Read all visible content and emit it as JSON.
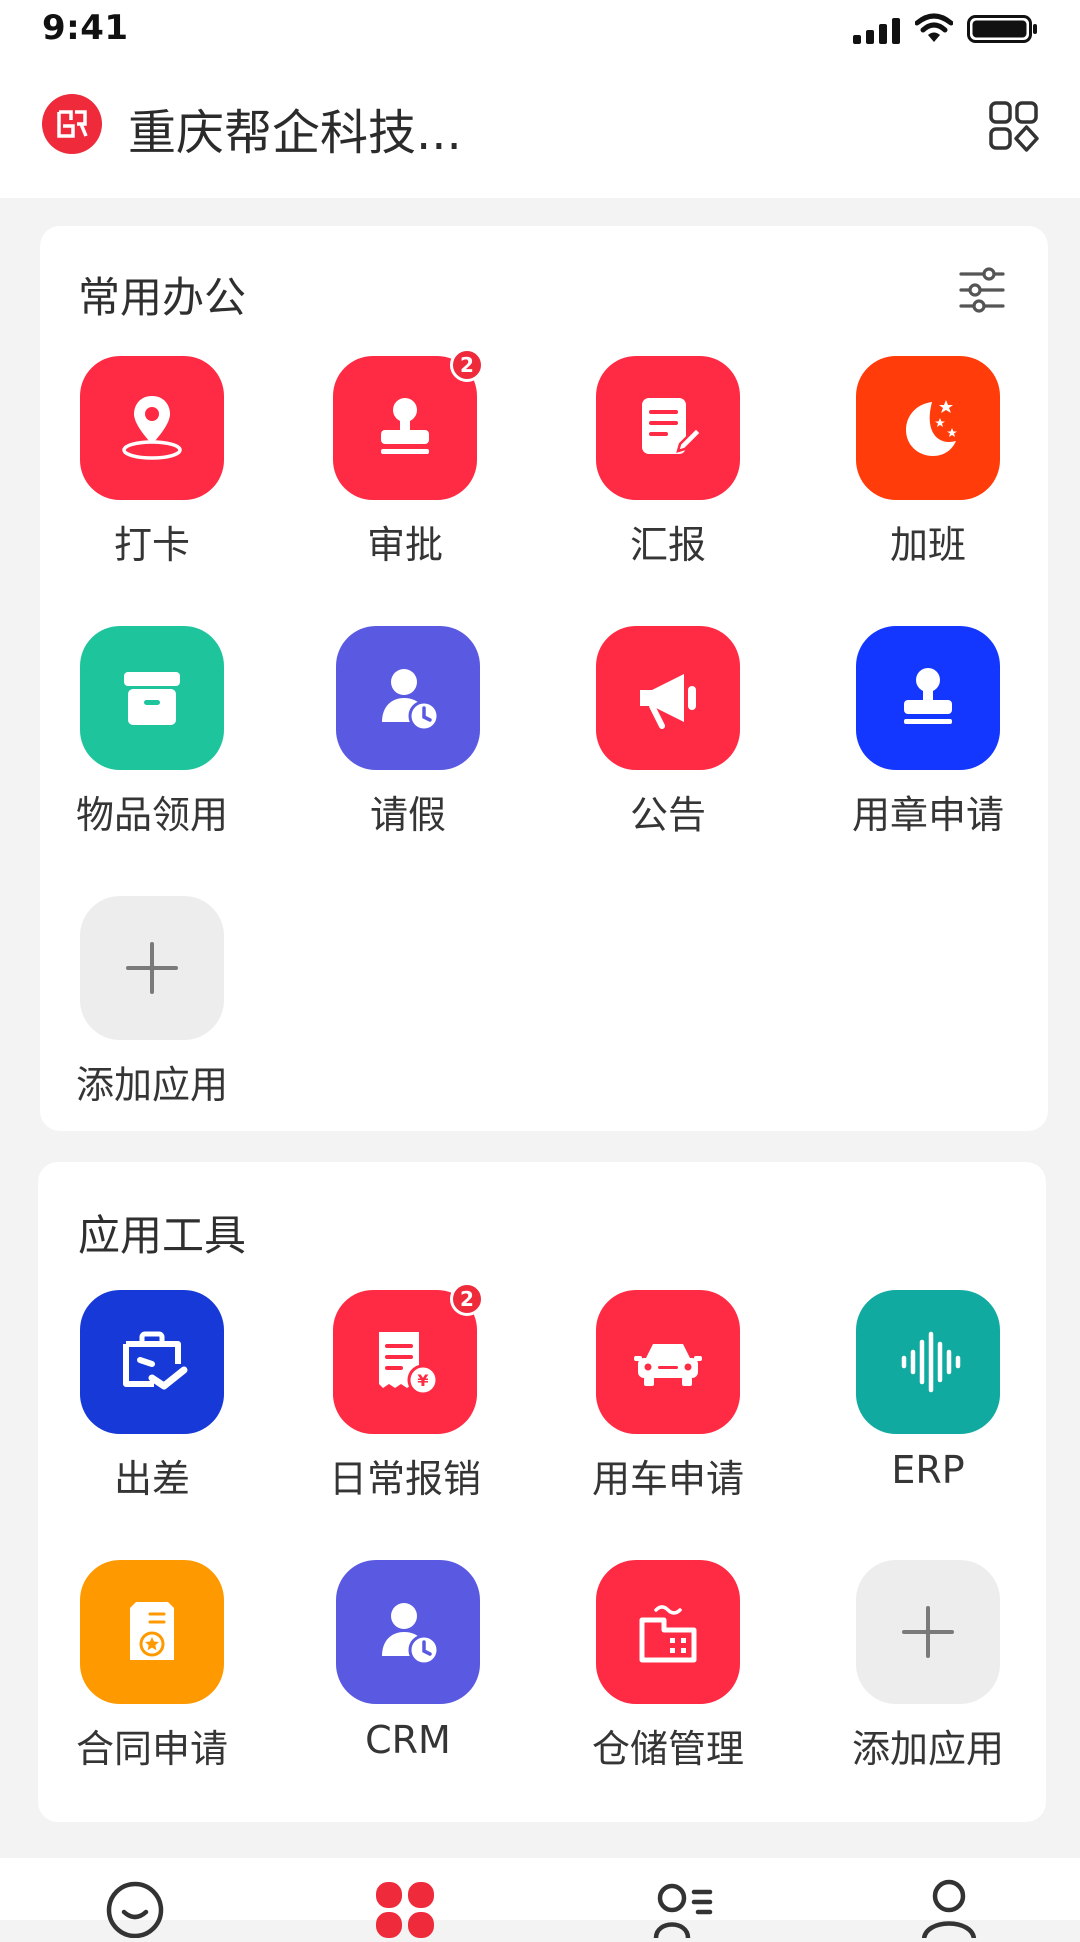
{
  "status": {
    "time": "9:41"
  },
  "header": {
    "company_name": "重庆帮企科技..."
  },
  "sections": [
    {
      "title": "常用办公",
      "apps": [
        {
          "label": "打卡",
          "icon": "location-pin-icon",
          "color": "#ff2a43"
        },
        {
          "label": "审批",
          "icon": "stamp-icon",
          "color": "#ff2a43",
          "badge": "2"
        },
        {
          "label": "汇报",
          "icon": "report-edit-icon",
          "color": "#ff2a43"
        },
        {
          "label": "加班",
          "icon": "moon-stars-icon",
          "color": "#ff3c0a"
        },
        {
          "label": "物品领用",
          "icon": "archive-box-icon",
          "color": "#1ec59c"
        },
        {
          "label": "请假",
          "icon": "person-clock-icon",
          "color": "#5a59e2"
        },
        {
          "label": "公告",
          "icon": "megaphone-icon",
          "color": "#ff2a43"
        },
        {
          "label": "用章申请",
          "icon": "seal-icon",
          "color": "#1437ff"
        },
        {
          "label": "添加应用",
          "icon": "plus-icon",
          "color": "#ededed"
        }
      ]
    },
    {
      "title": "应用工具",
      "apps": [
        {
          "label": "出差",
          "icon": "briefcase-plane-icon",
          "color": "#1739d8"
        },
        {
          "label": "日常报销",
          "icon": "receipt-yen-icon",
          "color": "#ff2a43",
          "badge": "2"
        },
        {
          "label": "用车申请",
          "icon": "car-icon",
          "color": "#ff2a43"
        },
        {
          "label": "ERP",
          "icon": "soundwave-icon",
          "color": "#10aaa0"
        },
        {
          "label": "合同申请",
          "icon": "contract-star-icon",
          "color": "#ff9900"
        },
        {
          "label": "CRM",
          "icon": "person-clock-icon",
          "color": "#5a59e2"
        },
        {
          "label": "仓储管理",
          "icon": "warehouse-icon",
          "color": "#ff2a43"
        },
        {
          "label": "添加应用",
          "icon": "plus-icon",
          "color": "#ededed"
        }
      ]
    }
  ],
  "tabbar": {
    "tabs": [
      {
        "icon": "message-icon"
      },
      {
        "icon": "workbench-icon",
        "active": true
      },
      {
        "icon": "contacts-icon"
      },
      {
        "icon": "profile-icon"
      }
    ]
  }
}
